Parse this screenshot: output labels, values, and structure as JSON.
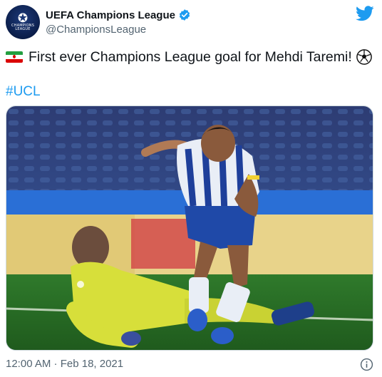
{
  "account": {
    "display_name": "UEFA Champions League",
    "handle": "@ChampionsLeague",
    "avatar_text": "CHAMPIONS LEAGUE",
    "verified": true
  },
  "tweet": {
    "text": "First ever Champions League goal for Mehdi Taremi!",
    "leading_emoji": "iran-flag-icon",
    "trailing_emoji": "soccer-ball-icon",
    "hashtag": "#UCL",
    "timestamp": "12:00 AM · Feb 18, 2021"
  },
  "colors": {
    "link": "#1d9bf0",
    "secondary_text": "#536471",
    "twitter_blue": "#1d9bf0"
  }
}
